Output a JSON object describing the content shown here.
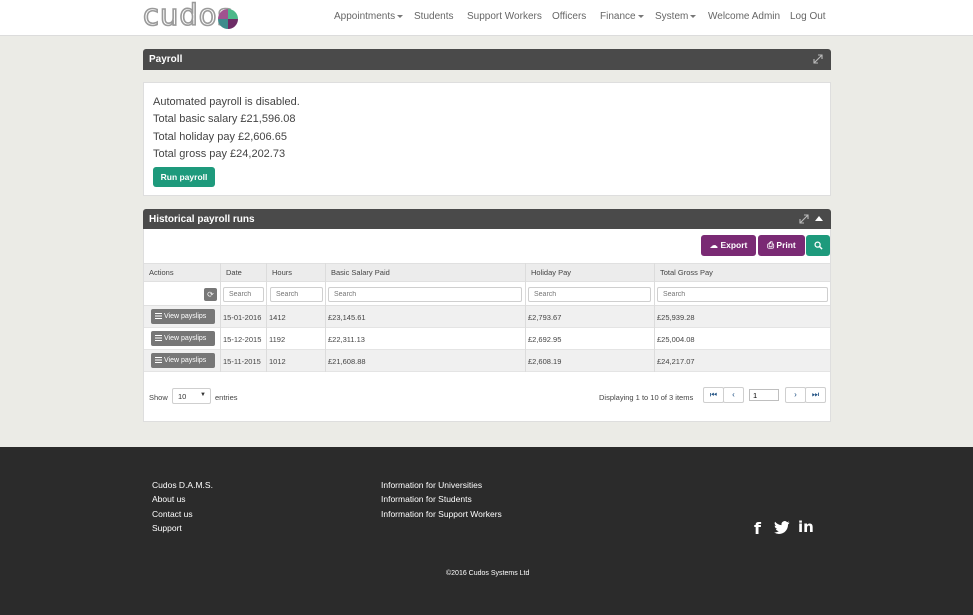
{
  "brand": {
    "logo_text": "cudos"
  },
  "nav": {
    "items": [
      {
        "label": "Appointments",
        "dropdown": true
      },
      {
        "label": "Students",
        "dropdown": false
      },
      {
        "label": "Support Workers",
        "dropdown": false
      },
      {
        "label": "Officers",
        "dropdown": false
      },
      {
        "label": "Finance",
        "dropdown": true
      },
      {
        "label": "System",
        "dropdown": true
      },
      {
        "label": "Welcome Admin",
        "dropdown": false
      },
      {
        "label": "Log Out",
        "dropdown": false
      }
    ]
  },
  "payroll": {
    "title": "Payroll",
    "status": "Automated payroll is disabled.",
    "basic_salary": "Total basic salary £21,596.08",
    "holiday_pay": "Total holiday pay £2,606.65",
    "gross_pay": "Total gross pay £24,202.73",
    "run_button": "Run payroll"
  },
  "history": {
    "title": "Historical payroll runs",
    "export_label": "Export",
    "print_label": "Print",
    "columns": [
      "Actions",
      "Date",
      "Hours",
      "Basic Salary Paid",
      "Holiday Pay",
      "Total Gross Pay"
    ],
    "search_placeholder": "Search",
    "view_label": "View payslips",
    "rows": [
      {
        "date": "15-01-2016",
        "hours": "1412",
        "basic": "£23,145.61",
        "holiday": "£2,793.67",
        "gross": "£25,939.28"
      },
      {
        "date": "15-12-2015",
        "hours": "1192",
        "basic": "£22,311.13",
        "holiday": "£2,692.95",
        "gross": "£25,004.08"
      },
      {
        "date": "15-11-2015",
        "hours": "1012",
        "basic": "£21,608.88",
        "holiday": "£2,608.19",
        "gross": "£24,217.07"
      }
    ],
    "show_label": "Show",
    "entries_value": "10",
    "entries_label": "entries",
    "displaying": "Displaying 1 to 10 of 3 items",
    "page_value": "1"
  },
  "footer": {
    "col1": [
      "Cudos D.A.M.S.",
      "About us",
      "Contact us",
      "Support"
    ],
    "col2": [
      "Information for Universities",
      "Information for Students",
      "Information for Support Workers"
    ],
    "copyright": "©2016 Cudos Systems Ltd",
    "social": [
      "facebook-icon",
      "twitter-icon",
      "linkedin-icon"
    ]
  },
  "colors": {
    "accent_green": "#1e9a7c",
    "accent_purple": "#7a2a74",
    "panel_header": "#4a4a4a",
    "footer_bg": "#2b2b2b"
  }
}
